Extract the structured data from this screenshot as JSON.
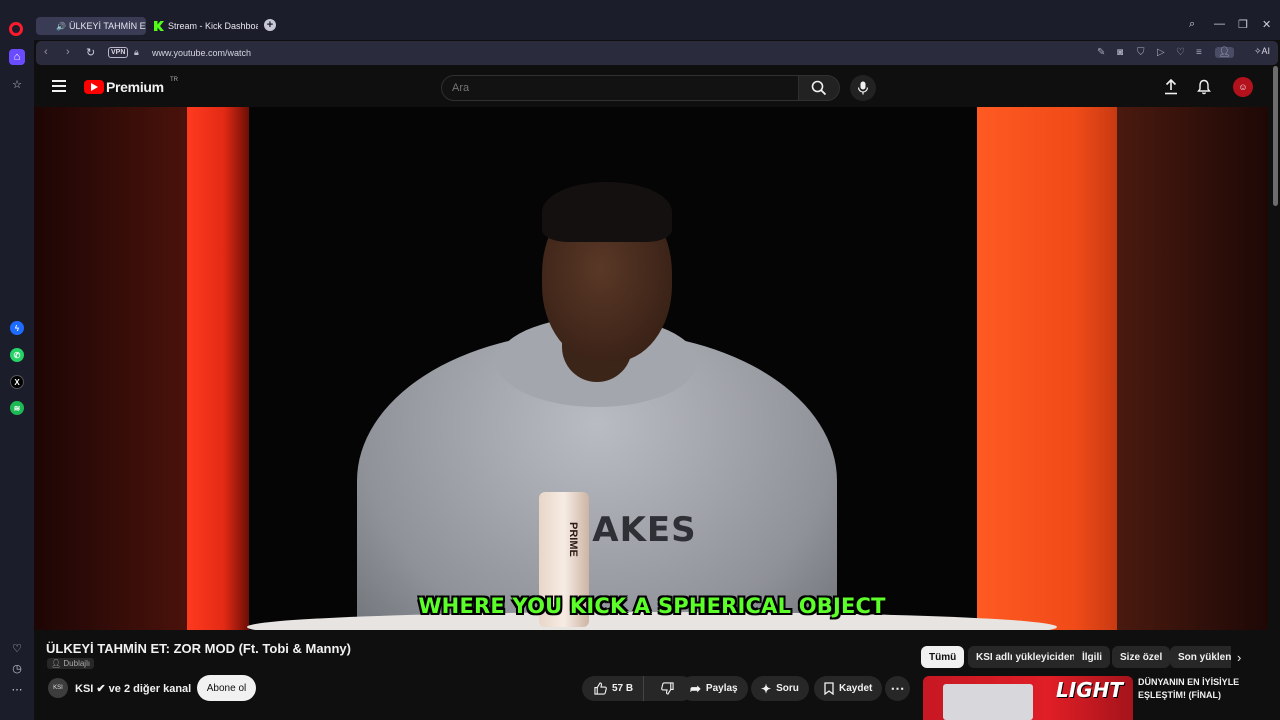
{
  "browser": {
    "tabs": [
      {
        "label": "ÜLKEYİ TAHMİN ET: ZOR MOD (Ft. Tobi & Manny)",
        "active": true
      },
      {
        "label": "Stream - Kick Dashboard",
        "active": false
      }
    ],
    "url": "www.youtube.com/watch",
    "vpn_label": "VPN",
    "ai_label": "AI"
  },
  "youtube": {
    "brand": "Premium",
    "region": "TR",
    "search_placeholder": "Ara"
  },
  "video": {
    "caption": "WHERE YOU KICK A SPHERICAL OBJECT",
    "shirt_print": "SNAKES",
    "can_label": "PRIME"
  },
  "watch": {
    "title": "ÜLKEYİ TAHMİN ET: ZOR MOD (Ft. Tobi & Manny)",
    "badge": "Dublajlı",
    "channel": "KSI ✔ ve 2 diğer kanal",
    "channel_avatar": "KSI",
    "subscribe_label": "Abone ol",
    "likes": "57 B",
    "share_label": "Paylaş",
    "ask_label": "Soru",
    "save_label": "Kaydet"
  },
  "chips": [
    {
      "label": "Tümü",
      "active": true
    },
    {
      "label": "KSI adlı yükleyiciden",
      "active": false
    },
    {
      "label": "İlgili",
      "active": false
    },
    {
      "label": "Size özel",
      "active": false
    },
    {
      "label": "Son yüklenenler",
      "active": false
    }
  ],
  "recommended": {
    "title": "DÜNYANIN EN İYİSİYLE EŞLEŞTİM! (FİNAL)",
    "thumb_logo": "LIGHT"
  },
  "colors": {
    "caption": "#5cff29",
    "brand_red": "#ff0000",
    "browser_bg": "#1c1d2b"
  }
}
